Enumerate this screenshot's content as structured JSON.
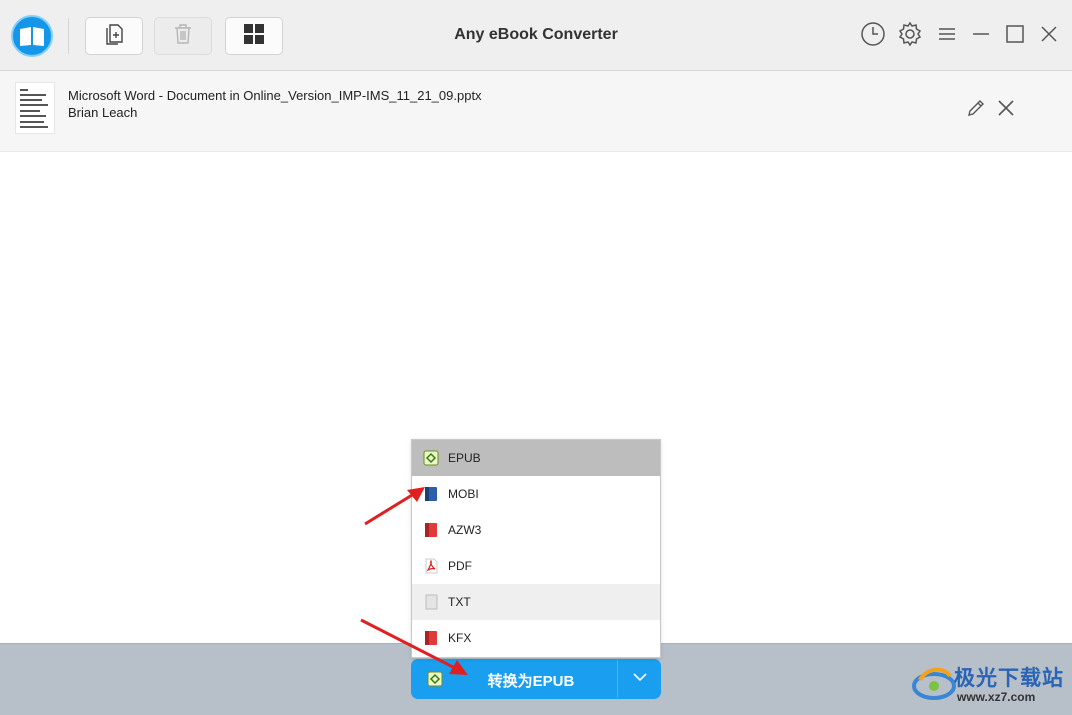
{
  "app": {
    "title": "Any eBook Converter"
  },
  "toolbar": {
    "add_icon": "add-file-icon",
    "delete_icon": "trash-icon",
    "grid_icon": "grid-icon"
  },
  "window_controls": [
    "history-icon",
    "settings-icon",
    "menu-icon",
    "minimize-icon",
    "maximize-icon",
    "close-icon"
  ],
  "file": {
    "name": "Microsoft Word - Document in Online_Version_IMP-IMS_11_21_09.pptx",
    "author": "Brian Leach"
  },
  "menu": {
    "items": [
      {
        "label": "EPUB",
        "icon": "epub-icon",
        "state": "selected"
      },
      {
        "label": "MOBI",
        "icon": "mobi-icon",
        "state": "normal"
      },
      {
        "label": "AZW3",
        "icon": "azw3-icon",
        "state": "normal"
      },
      {
        "label": "PDF",
        "icon": "pdf-icon",
        "state": "normal"
      },
      {
        "label": "TXT",
        "icon": "txt-icon",
        "state": "hover"
      },
      {
        "label": "KFX",
        "icon": "kfx-icon",
        "state": "normal"
      }
    ]
  },
  "convert": {
    "label": "转换为EPUB"
  },
  "watermark": {
    "brand": "极光下载站",
    "url": "www.xz7.com"
  },
  "colors": {
    "accent": "#1a9ff0",
    "selected_bg": "#bdbdbd",
    "hover_bg": "#efefef",
    "arrow": "#e02020"
  }
}
